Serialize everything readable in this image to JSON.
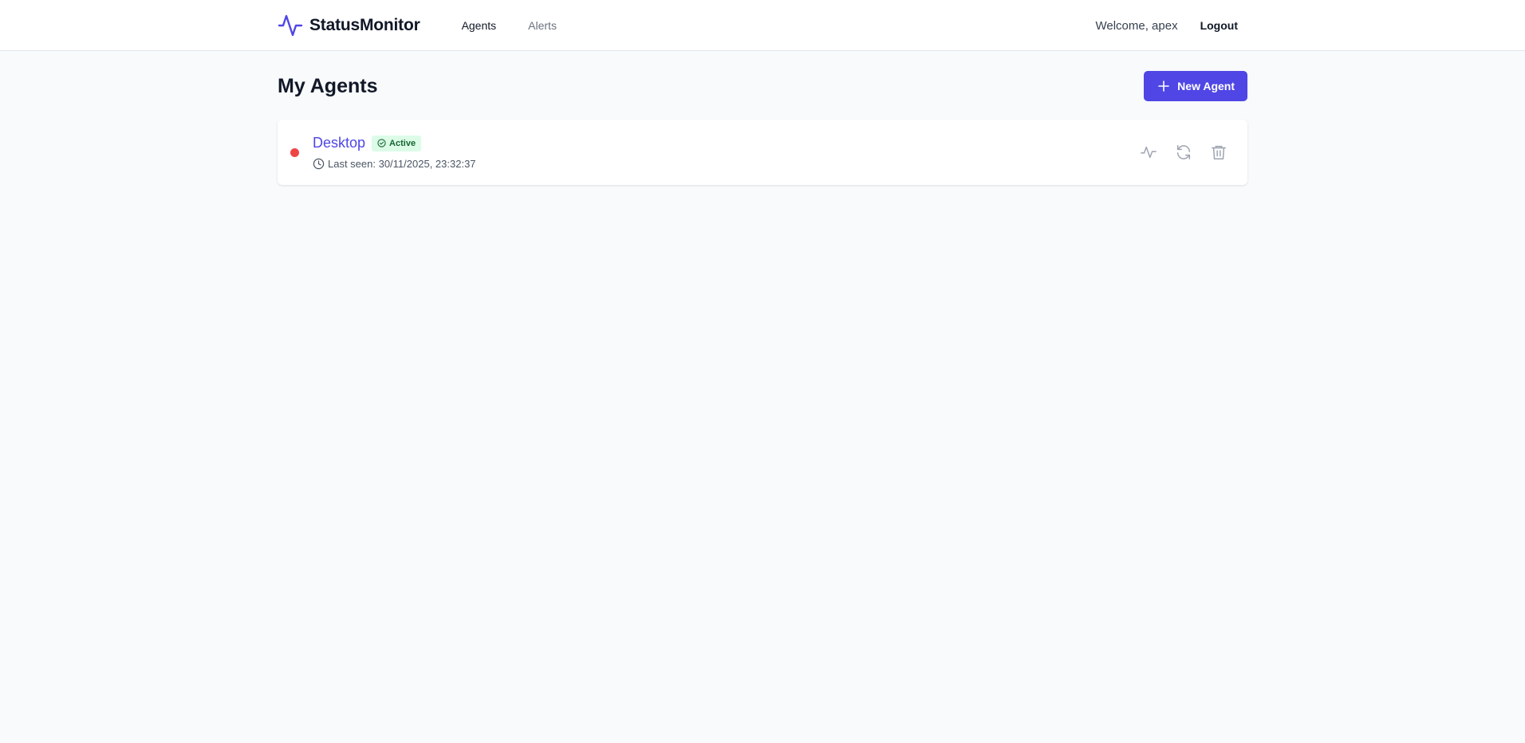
{
  "app": {
    "name": "StatusMonitor",
    "brand_color": "#4f46e5"
  },
  "nav": {
    "items": [
      {
        "label": "Agents",
        "active": true
      },
      {
        "label": "Alerts",
        "active": false
      }
    ]
  },
  "user": {
    "welcome": "Welcome, apex",
    "logout_label": "Logout"
  },
  "page": {
    "title": "My Agents",
    "new_agent_label": "New Agent"
  },
  "agents": [
    {
      "name": "Desktop",
      "status_dot_color": "#ef4444",
      "badge": "Active",
      "last_seen": "Last seen: 30/11/2025, 23:32:37",
      "actions": [
        "activity-icon",
        "refresh-icon",
        "trash-icon"
      ]
    }
  ]
}
